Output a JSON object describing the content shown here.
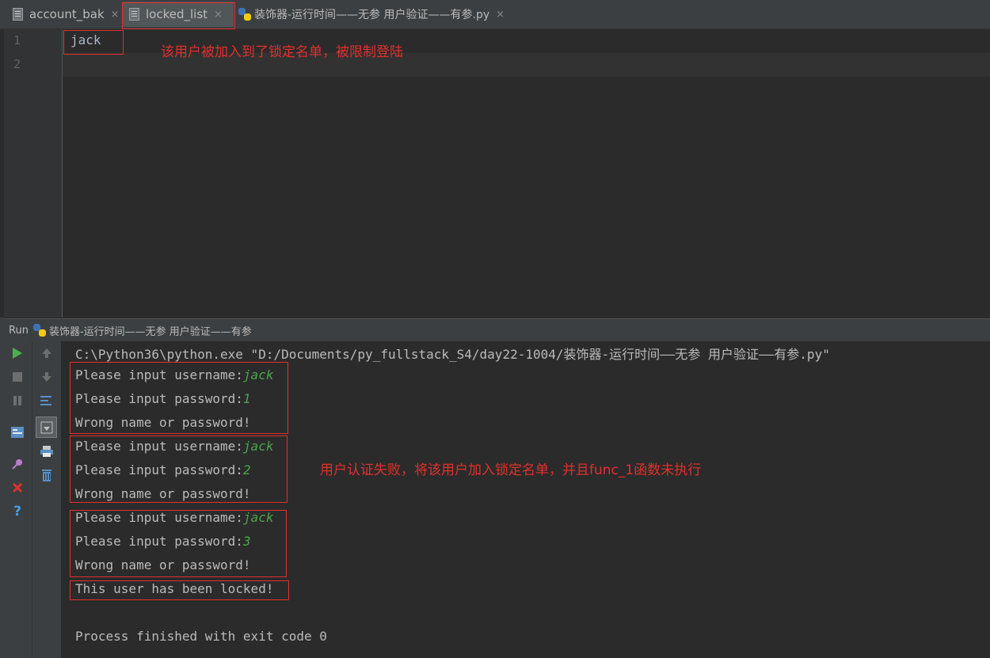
{
  "tabs": [
    {
      "label": "account_bak",
      "close": "×"
    },
    {
      "label": "locked_list",
      "close": "×"
    },
    {
      "label": "装饰器-运行时间——无参 用户验证——有参.py",
      "close": "×"
    }
  ],
  "editor": {
    "line_numbers": [
      "1",
      "2"
    ],
    "lines": [
      "jack",
      ""
    ],
    "annotation": "该用户被加入到了锁定名单，被限制登陆"
  },
  "run": {
    "label": "Run",
    "config_name": "装饰器-运行时间——无参 用户验证——有参"
  },
  "console": {
    "command": "C:\\Python36\\python.exe \"D:/Documents/py_fullstack_S4/day22-1004/装饰器-运行时间——无参 用户验证——有参.py\"",
    "username_prompt": "Please input username:",
    "password_prompt": "Please input password:",
    "wrong_msg": "Wrong name or password!",
    "attempts": [
      {
        "username": "jack",
        "password": "1"
      },
      {
        "username": "jack",
        "password": "2"
      },
      {
        "username": "jack",
        "password": "3"
      }
    ],
    "locked_msg": "This user has been locked!",
    "exit_msg": "Process finished with exit code 0",
    "annotation": "用户认证失败，将该用户加入锁定名单，并且func_1函数未执行"
  },
  "colors": {
    "annotation_red": "#e1302d",
    "input_green": "#4aa54a",
    "run_green": "#4caf50"
  },
  "icons": {
    "run": "run-icon",
    "stop": "stop-icon",
    "pause": "pause-icon",
    "up": "up-arrow-icon",
    "down": "down-arrow-icon",
    "close": "close-icon",
    "help": "help-icon",
    "trash": "trash-icon",
    "print": "print-icon"
  }
}
